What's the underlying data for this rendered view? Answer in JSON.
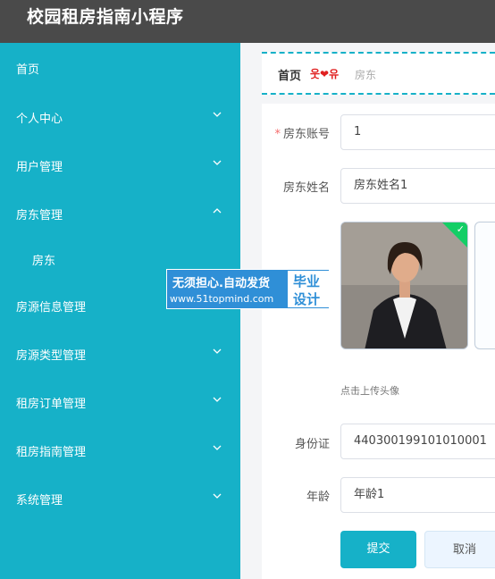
{
  "app": {
    "title": "校园租房指南小程序"
  },
  "sidebar": {
    "items": [
      {
        "label": "首页"
      },
      {
        "label": "个人中心"
      },
      {
        "label": "用户管理"
      },
      {
        "label": "房东管理"
      },
      {
        "label": "房东"
      },
      {
        "label": "房源信息管理"
      },
      {
        "label": "房源类型管理"
      },
      {
        "label": "租房订单管理"
      },
      {
        "label": "租房指南管理"
      },
      {
        "label": "系统管理"
      }
    ]
  },
  "breadcrumb": {
    "home": "首页",
    "separator": "웃❤유",
    "current": "房东"
  },
  "form": {
    "account": {
      "label": "房东账号",
      "value": "1"
    },
    "name": {
      "label": "房东姓名",
      "value": "房东姓名1"
    },
    "avatar": {
      "tip": "点击上传头像"
    },
    "idcard": {
      "label": "身份证",
      "value": "440300199101010001"
    },
    "age": {
      "label": "年龄",
      "value": "年龄1"
    },
    "submit_label": "提交",
    "cancel_label": "取消"
  },
  "watermark": {
    "line1": "无须担心.自动发货",
    "line2": "www.51topmind.com",
    "right1": "毕业",
    "right2": "设计"
  },
  "colors": {
    "sidebar": "#16b1c8",
    "topbar": "#4a4a4a",
    "accent": "#16b1c8",
    "success": "#13ce66"
  }
}
